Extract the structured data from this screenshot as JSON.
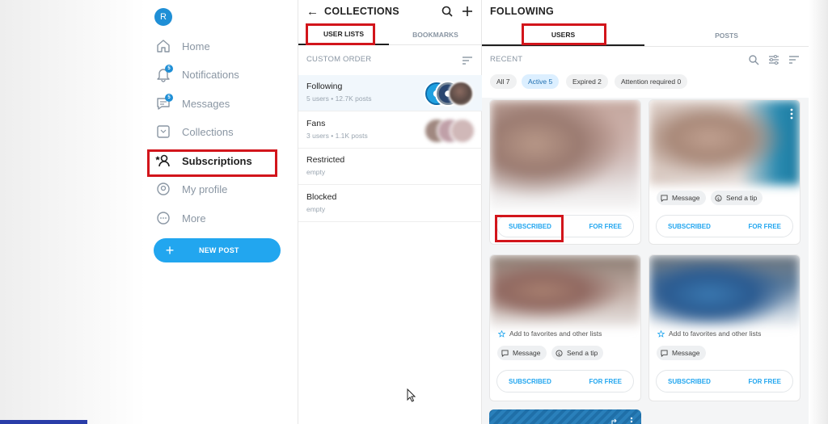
{
  "sidebar": {
    "avatar_letter": "R",
    "items": [
      {
        "label": "Home",
        "icon": "home-icon"
      },
      {
        "label": "Notifications",
        "icon": "bell-icon",
        "badge": "5"
      },
      {
        "label": "Messages",
        "icon": "message-icon",
        "badge": "5"
      },
      {
        "label": "Collections",
        "icon": "collections-icon"
      },
      {
        "label": "Subscriptions",
        "icon": "subscriptions-icon"
      },
      {
        "label": "My profile",
        "icon": "profile-icon"
      },
      {
        "label": "More",
        "icon": "more-icon"
      }
    ],
    "new_post_label": "NEW POST"
  },
  "collections": {
    "title": "COLLECTIONS",
    "tabs": [
      "USER LISTS",
      "BOOKMARKS"
    ],
    "section_label": "CUSTOM ORDER",
    "lists": [
      {
        "name": "Following",
        "meta": "5 users • 12.7K posts"
      },
      {
        "name": "Fans",
        "meta": "3 users • 1.1K posts"
      },
      {
        "name": "Restricted",
        "meta": "empty"
      },
      {
        "name": "Blocked",
        "meta": "empty"
      }
    ]
  },
  "following": {
    "title": "FOLLOWING",
    "tabs": [
      "USERS",
      "POSTS"
    ],
    "section_label": "RECENT",
    "chips": [
      "All 7",
      "Active 5",
      "Expired 2",
      "Attention required 0"
    ],
    "cards": [
      {
        "subscribed": "SUBSCRIBED",
        "price": "FOR FREE"
      },
      {
        "subscribed": "SUBSCRIBED",
        "price": "FOR FREE",
        "message": "Message",
        "tip": "Send a tip"
      },
      {
        "subscribed": "SUBSCRIBED",
        "price": "FOR FREE",
        "message": "Message",
        "tip": "Send a tip",
        "fav": "Add to favorites and other lists"
      },
      {
        "subscribed": "SUBSCRIBED",
        "price": "FOR FREE",
        "message": "Message",
        "fav": "Add to favorites and other lists"
      }
    ]
  },
  "colors": {
    "accent": "#22a6ef",
    "highlight_box": "#d2151b",
    "muted_text": "#8a96a3"
  }
}
